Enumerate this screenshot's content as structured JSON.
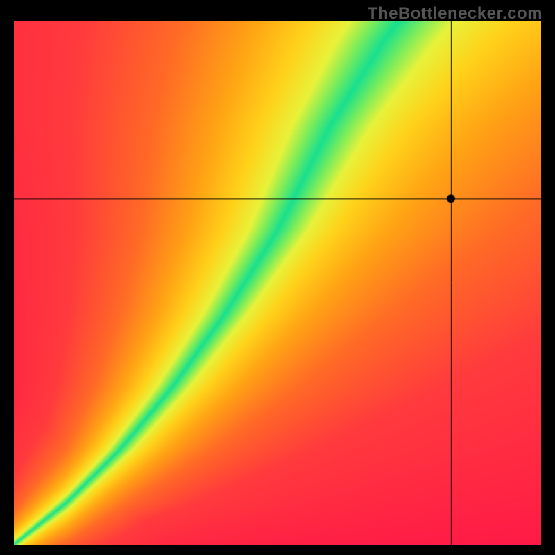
{
  "watermark": "TheBottlenecker.com",
  "chart_data": {
    "type": "heatmap",
    "title": "",
    "xlabel": "",
    "ylabel": "",
    "xlim": [
      0,
      1
    ],
    "ylim": [
      0,
      1
    ],
    "crosshair": {
      "x": 0.83,
      "y": 0.66
    },
    "ideal_line": {
      "description": "green zero-bottleneck curve, piecewise: near y≈x for small x, then steepening to top",
      "points": [
        {
          "x": 0.0,
          "y": 0.0
        },
        {
          "x": 0.1,
          "y": 0.08
        },
        {
          "x": 0.2,
          "y": 0.18
        },
        {
          "x": 0.3,
          "y": 0.3
        },
        {
          "x": 0.4,
          "y": 0.44
        },
        {
          "x": 0.5,
          "y": 0.6
        },
        {
          "x": 0.55,
          "y": 0.7
        },
        {
          "x": 0.6,
          "y": 0.8
        },
        {
          "x": 0.65,
          "y": 0.88
        },
        {
          "x": 0.7,
          "y": 0.96
        },
        {
          "x": 0.73,
          "y": 1.0
        }
      ]
    },
    "color_scale": {
      "description": "distance from ideal line: 0=green, mid=yellow/orange, far=red; upper-right corner trends yellow",
      "stops": [
        {
          "d": 0.0,
          "color": "#18e08f"
        },
        {
          "d": 0.04,
          "color": "#7ded5a"
        },
        {
          "d": 0.08,
          "color": "#e8f23a"
        },
        {
          "d": 0.15,
          "color": "#ffd21a"
        },
        {
          "d": 0.25,
          "color": "#ffa414"
        },
        {
          "d": 0.4,
          "color": "#ff6a26"
        },
        {
          "d": 0.6,
          "color": "#ff3a3d"
        },
        {
          "d": 1.0,
          "color": "#ff1a46"
        }
      ]
    },
    "marker": {
      "x": 0.83,
      "y": 0.66,
      "color": "#000000",
      "radius_px": 6
    }
  }
}
